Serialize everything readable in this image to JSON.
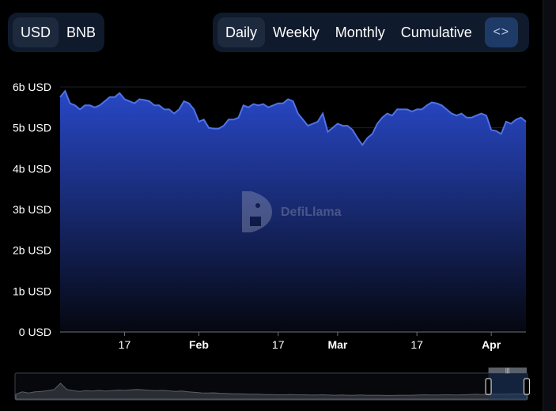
{
  "currency_toggle": {
    "options": [
      {
        "label": "USD",
        "active": true
      },
      {
        "label": "BNB",
        "active": false
      }
    ]
  },
  "period_toggle": {
    "options": [
      {
        "label": "Daily",
        "active": true
      },
      {
        "label": "Weekly",
        "active": false
      },
      {
        "label": "Monthly",
        "active": false
      },
      {
        "label": "Cumulative",
        "active": false
      }
    ],
    "embed_icon": "code-brackets-icon",
    "embed_glyph": "<>"
  },
  "watermark": {
    "text": "DefiLlama",
    "icon": "llama-logo-icon"
  },
  "colors": {
    "line": "#4f72e8",
    "fill_top": "#2a4bd0",
    "fill_bottom": "#05070f",
    "accent_button": "#1e3a66",
    "segment_bg": "#0f1a2c"
  },
  "chart_data": {
    "type": "area",
    "title": "",
    "xlabel": "",
    "ylabel": "",
    "ylim": [
      0,
      6
    ],
    "y_unit": "b USD",
    "y_ticks": [
      "0 USD",
      "1b USD",
      "2b USD",
      "3b USD",
      "4b USD",
      "5b USD",
      "6b USD"
    ],
    "x_ticks": [
      {
        "label": "17",
        "index": 13,
        "bold": false
      },
      {
        "label": "Feb",
        "index": 28,
        "bold": true
      },
      {
        "label": "17",
        "index": 44,
        "bold": false
      },
      {
        "label": "Mar",
        "index": 56,
        "bold": true
      },
      {
        "label": "17",
        "index": 72,
        "bold": false
      },
      {
        "label": "Apr",
        "index": 87,
        "bold": true
      }
    ],
    "grid": true,
    "series": [
      {
        "values": [
          5.75,
          5.9,
          5.6,
          5.55,
          5.45,
          5.55,
          5.55,
          5.5,
          5.55,
          5.65,
          5.75,
          5.75,
          5.85,
          5.7,
          5.65,
          5.6,
          5.7,
          5.68,
          5.65,
          5.55,
          5.55,
          5.45,
          5.45,
          5.35,
          5.45,
          5.65,
          5.6,
          5.45,
          5.15,
          5.2,
          5.0,
          4.98,
          4.98,
          5.05,
          5.2,
          5.2,
          5.25,
          5.55,
          5.5,
          5.58,
          5.55,
          5.58,
          5.5,
          5.55,
          5.6,
          5.6,
          5.7,
          5.65,
          5.35,
          5.2,
          5.05,
          5.1,
          5.15,
          5.35,
          4.9,
          5.0,
          5.1,
          5.05,
          5.05,
          4.95,
          4.75,
          4.58,
          4.75,
          4.85,
          5.1,
          5.25,
          5.35,
          5.3,
          5.45,
          5.45,
          5.45,
          5.4,
          5.45,
          5.45,
          5.55,
          5.62,
          5.6,
          5.55,
          5.45,
          5.35,
          5.3,
          5.35,
          5.25,
          5.25,
          5.3,
          5.35,
          5.3,
          4.95,
          4.92,
          4.85,
          5.15,
          5.1,
          5.2,
          5.25,
          5.15
        ]
      }
    ]
  },
  "brush": {
    "overview_values": [
      2,
      3,
      2.5,
      3,
      3.2,
      3.5,
      4,
      6.5,
      4,
      3.5,
      3.2,
      3.5,
      3.3,
      3.6,
      3.3,
      3.5,
      3.7,
      3.6,
      3.8,
      4,
      3.8,
      3.6,
      3.5,
      3.6,
      3.4,
      3.2,
      3.3,
      3.0,
      2.8,
      2.6,
      2.5,
      2.6,
      2.4,
      2.3,
      2.2,
      2.2,
      2.1,
      2.0,
      2.0,
      1.9,
      1.9,
      1.8,
      1.8,
      1.9,
      1.8,
      1.8,
      1.7,
      1.7,
      1.8,
      1.7,
      1.6,
      1.7,
      1.6,
      1.6,
      1.7,
      1.6,
      1.6,
      1.6,
      1.5,
      1.5,
      1.6,
      1.6,
      1.6,
      1.7,
      1.8,
      1.7,
      1.7,
      1.8,
      1.8,
      1.7,
      1.8,
      1.9,
      2.0,
      1.9,
      2.0,
      2.1,
      2.0,
      2.1,
      2.2,
      2.1,
      2.1
    ],
    "selected_start_fraction": 0.925,
    "selected_end_fraction": 1.0,
    "handle_glyph": "|||"
  }
}
